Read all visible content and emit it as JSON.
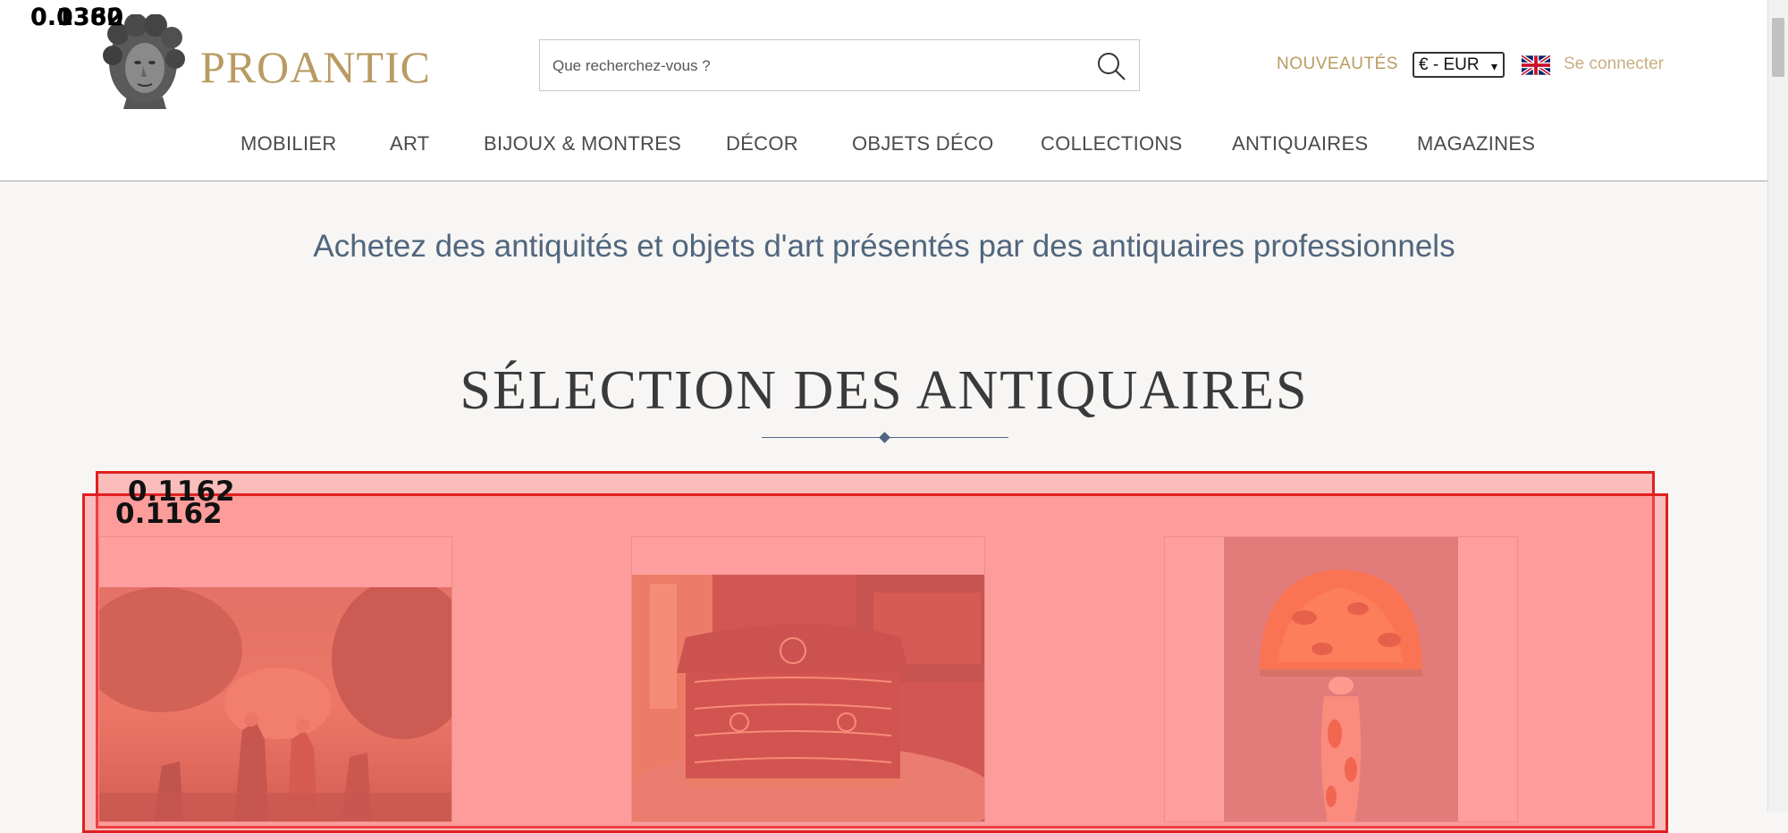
{
  "header": {
    "brand": "PROANTIC",
    "search": {
      "placeholder": "Que recherchez-vous ?"
    },
    "new_link": "NOUVEAUTÉS",
    "currency": "€ - EUR",
    "login": "Se connecter",
    "language_flag": "uk-flag-icon",
    "logo_icon": "classical-bust-icon",
    "search_icon": "magnifier-icon"
  },
  "nav": {
    "items": [
      {
        "label": "MOBILIER"
      },
      {
        "label": "ART"
      },
      {
        "label": "BIJOUX & MONTRES"
      },
      {
        "label": "DÉCOR"
      },
      {
        "label": "OBJETS DÉCO"
      },
      {
        "label": "COLLECTIONS"
      },
      {
        "label": "ANTIQUAIRES"
      },
      {
        "label": "MAGAZINES"
      }
    ]
  },
  "main": {
    "tagline": "Achetez des antiquités et objets d'art présentés par des antiquaires professionnels",
    "section_title": "SÉLECTION DES ANTIQUAIRES",
    "products": [
      {
        "subject": "classical-painting"
      },
      {
        "subject": "boulle-marquetry-box"
      },
      {
        "subject": "galle-cameo-glass-lamp"
      }
    ]
  },
  "overlays": {
    "corner_label_a": "0.1380",
    "corner_label_b": "0.0362",
    "box_label_a": "0.1162",
    "box_label_b": "0.1162"
  },
  "colors": {
    "brand_gold": "#b89b62",
    "slate_blue": "#51667e",
    "overlay_red": "#e02020"
  }
}
